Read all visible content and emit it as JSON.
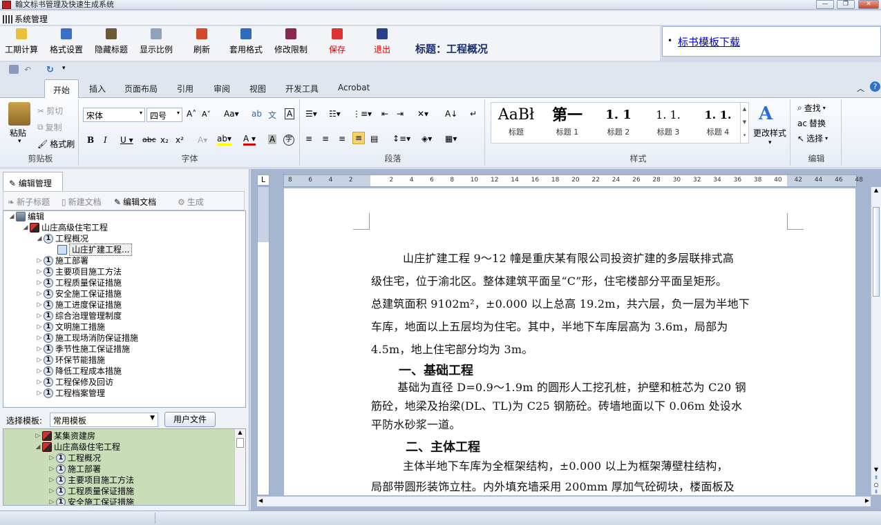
{
  "window": {
    "title": "翰文标书管理及快速生成系统"
  },
  "menu": {
    "system": "系统管理"
  },
  "toolbar": {
    "items": [
      "工期计算",
      "格式设置",
      "隐藏标题",
      "显示比例",
      "刷新",
      "套用格式",
      "修改限制",
      "保存",
      "退出"
    ],
    "title_label": "标题：工程概况"
  },
  "link_panel": {
    "link": "标书模板下载"
  },
  "ribbon": {
    "tabs": [
      "开始",
      "插入",
      "页面布局",
      "引用",
      "审阅",
      "视图",
      "开发工具",
      "Acrobat"
    ],
    "clipboard": {
      "paste": "粘贴",
      "cut": "剪切",
      "copy": "复制",
      "format_painter": "格式刷",
      "label": "剪贴板"
    },
    "font": {
      "name": "宋体",
      "size": "四号",
      "label": "字体"
    },
    "paragraph": {
      "label": "段落"
    },
    "styles": {
      "items": [
        {
          "preview": "AaBł",
          "name": "标题"
        },
        {
          "preview": "第一",
          "name": "标题 1"
        },
        {
          "preview": "1. 1",
          "name": "标题 2"
        },
        {
          "preview": "1. 1.",
          "name": "标题 3"
        },
        {
          "preview": "1. 1.",
          "name": "标题 4"
        }
      ],
      "change": "更改样式",
      "label": "样式"
    },
    "editing": {
      "find": "查找",
      "replace": "替换",
      "select": "选择",
      "label": "编辑"
    }
  },
  "left_panel": {
    "tab": "编辑管理",
    "actions": [
      "新子标题",
      "新建文档",
      "编辑文档",
      "生成"
    ],
    "tree": {
      "root": "编辑",
      "project": "山庄高级住宅工程",
      "overview": "工程概况",
      "doc": "山庄扩建工程...",
      "sections": [
        "施工部署",
        "主要项目施工方法",
        "工程质量保证措施",
        "安全施工保证措施",
        "施工进度保证措施",
        "综合治理管理制度",
        "文明施工措施",
        "施工现场消防保证措施",
        "季节性施工保证措施",
        "环保节能措施",
        "降低工程成本措施",
        "工程保修及回访",
        "工程档案管理"
      ]
    },
    "template": {
      "label": "选择模板:",
      "value": "常用模板",
      "user_file_button": "用户文件"
    },
    "tree2": {
      "items": [
        "某集资建房",
        "山庄高级住宅工程"
      ],
      "children": [
        "工程概况",
        "施工部署",
        "主要项目施工方法",
        "工程质量保证措施",
        "安全施工保证措施"
      ]
    }
  },
  "ruler": {
    "ticks": [
      "8",
      "6",
      "4",
      "2",
      "",
      "2",
      "4",
      "6",
      "8",
      "10",
      "12",
      "14",
      "16",
      "18",
      "20",
      "22",
      "24",
      "26",
      "28",
      "30",
      "32",
      "34",
      "36",
      "38",
      "40",
      "42",
      "44",
      "46",
      "48"
    ]
  },
  "document": {
    "para1_lines": [
      "山庄扩建工程 9～12 幢是重庆某有限公司投资扩建的多层联排式高",
      "级住宅，位于渝北区。整体建筑平面呈“C”形，住宅楼部分平面呈矩形。",
      "总建筑面积 9102m²，±0.000 以上总高 19.2m，共六层，负一层为半地下",
      "车库，地面以上五层均为住宅。其中，半地下车库层高为 3.6m，局部为",
      "4.5m，地上住宅部分均为 3m。"
    ],
    "heading1": "一、基础工程",
    "para2_lines": [
      "基础为直径 D=0.9～1.9m 的圆形人工挖孔桩，护壁和桩芯为 C20 钢",
      "筋砼，地梁及抬梁(DL、TL)为 C25 钢筋砼。砖墙地面以下 0.06m 处设水",
      "平防水砂浆一道。"
    ],
    "heading2": "二、主体工程",
    "para3_lines": [
      "主体半地下车库为全框架结构，±0.000 以上为框架薄壁柱结构，",
      "局部带圆形装饰立柱。内外填充墙采用 200mm 厚加气砼砌块，楼面板及"
    ]
  }
}
